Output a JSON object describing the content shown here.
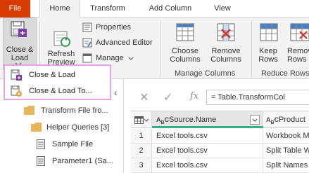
{
  "tabs": {
    "file": "File",
    "home": "Home",
    "transform": "Transform",
    "add_column": "Add Column",
    "view": "View"
  },
  "ribbon": {
    "close_load": {
      "line1": "Close &",
      "line2": "Load"
    },
    "refresh_preview": {
      "line1": "Refresh",
      "line2": "Preview"
    },
    "properties": "Properties",
    "advanced_editor": "Advanced Editor",
    "manage": "Manage",
    "choose_columns": {
      "line1": "Choose",
      "line2": "Columns"
    },
    "remove_columns": {
      "line1": "Remove",
      "line2": "Columns"
    },
    "keep_rows": {
      "line1": "Keep",
      "line2": "Rows"
    },
    "remove_rows": {
      "line1": "Remov",
      "line2": "Rows"
    },
    "group_manage_columns": "Manage Columns",
    "group_reduce_rows": "Reduce Rows"
  },
  "close_load_menu": {
    "items": [
      "Close & Load",
      "Close & Load To..."
    ]
  },
  "queries_pane": {
    "items": [
      {
        "label": "Transform File fro...",
        "icon": "folder-icon"
      },
      {
        "label": "Helper Queries [3]",
        "icon": "folder-icon"
      },
      {
        "label": "Sample File",
        "icon": "table-icon"
      },
      {
        "label": "Parameter1 (Sa...",
        "icon": "table-icon"
      }
    ]
  },
  "formula_bar": {
    "fx": "fx",
    "formula": "= Table.TransformCol"
  },
  "grid": {
    "columns": [
      "Source.Name",
      "Product"
    ],
    "rows": [
      {
        "num": "1",
        "source": "Excel tools.csv",
        "product": "Workbook M"
      },
      {
        "num": "2",
        "source": "Excel tools.csv",
        "product": "Split Table W"
      },
      {
        "num": "3",
        "source": "Excel tools.csv",
        "product": "Split Names t"
      }
    ]
  },
  "colors": {
    "file_tab": "#d83b01",
    "menu_border": "#e7a3e5",
    "column_accent": "#3cae8e",
    "folder": "#e8b55a"
  }
}
